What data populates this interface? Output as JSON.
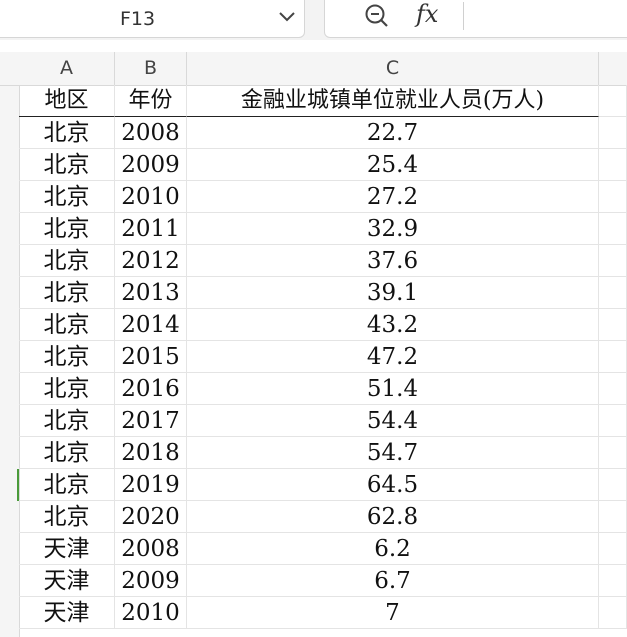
{
  "name_box": {
    "cell_ref": "F13"
  },
  "formula_bar": {
    "zoom_icon": "zoom-out-icon",
    "fx_label": "fx",
    "content": ""
  },
  "columns": [
    "A",
    "B",
    "C"
  ],
  "selected_row_index": 11,
  "table": {
    "header": [
      "地区",
      "年份",
      "金融业城镇单位就业人员(万人)"
    ],
    "rows": [
      [
        "北京",
        "2008",
        "22.7"
      ],
      [
        "北京",
        "2009",
        "25.4"
      ],
      [
        "北京",
        "2010",
        "27.2"
      ],
      [
        "北京",
        "2011",
        "32.9"
      ],
      [
        "北京",
        "2012",
        "37.6"
      ],
      [
        "北京",
        "2013",
        "39.1"
      ],
      [
        "北京",
        "2014",
        "43.2"
      ],
      [
        "北京",
        "2015",
        "47.2"
      ],
      [
        "北京",
        "2016",
        "51.4"
      ],
      [
        "北京",
        "2017",
        "54.4"
      ],
      [
        "北京",
        "2018",
        "54.7"
      ],
      [
        "北京",
        "2019",
        "64.5"
      ],
      [
        "北京",
        "2020",
        "62.8"
      ],
      [
        "天津",
        "2008",
        "6.2"
      ],
      [
        "天津",
        "2009",
        "6.7"
      ],
      [
        "天津",
        "2010",
        "7"
      ]
    ]
  },
  "colors": {
    "selected_row_marker": "#4a9a3a",
    "header_bg": "#f5f5f5",
    "toolbar_bg": "#f3f3f3"
  }
}
